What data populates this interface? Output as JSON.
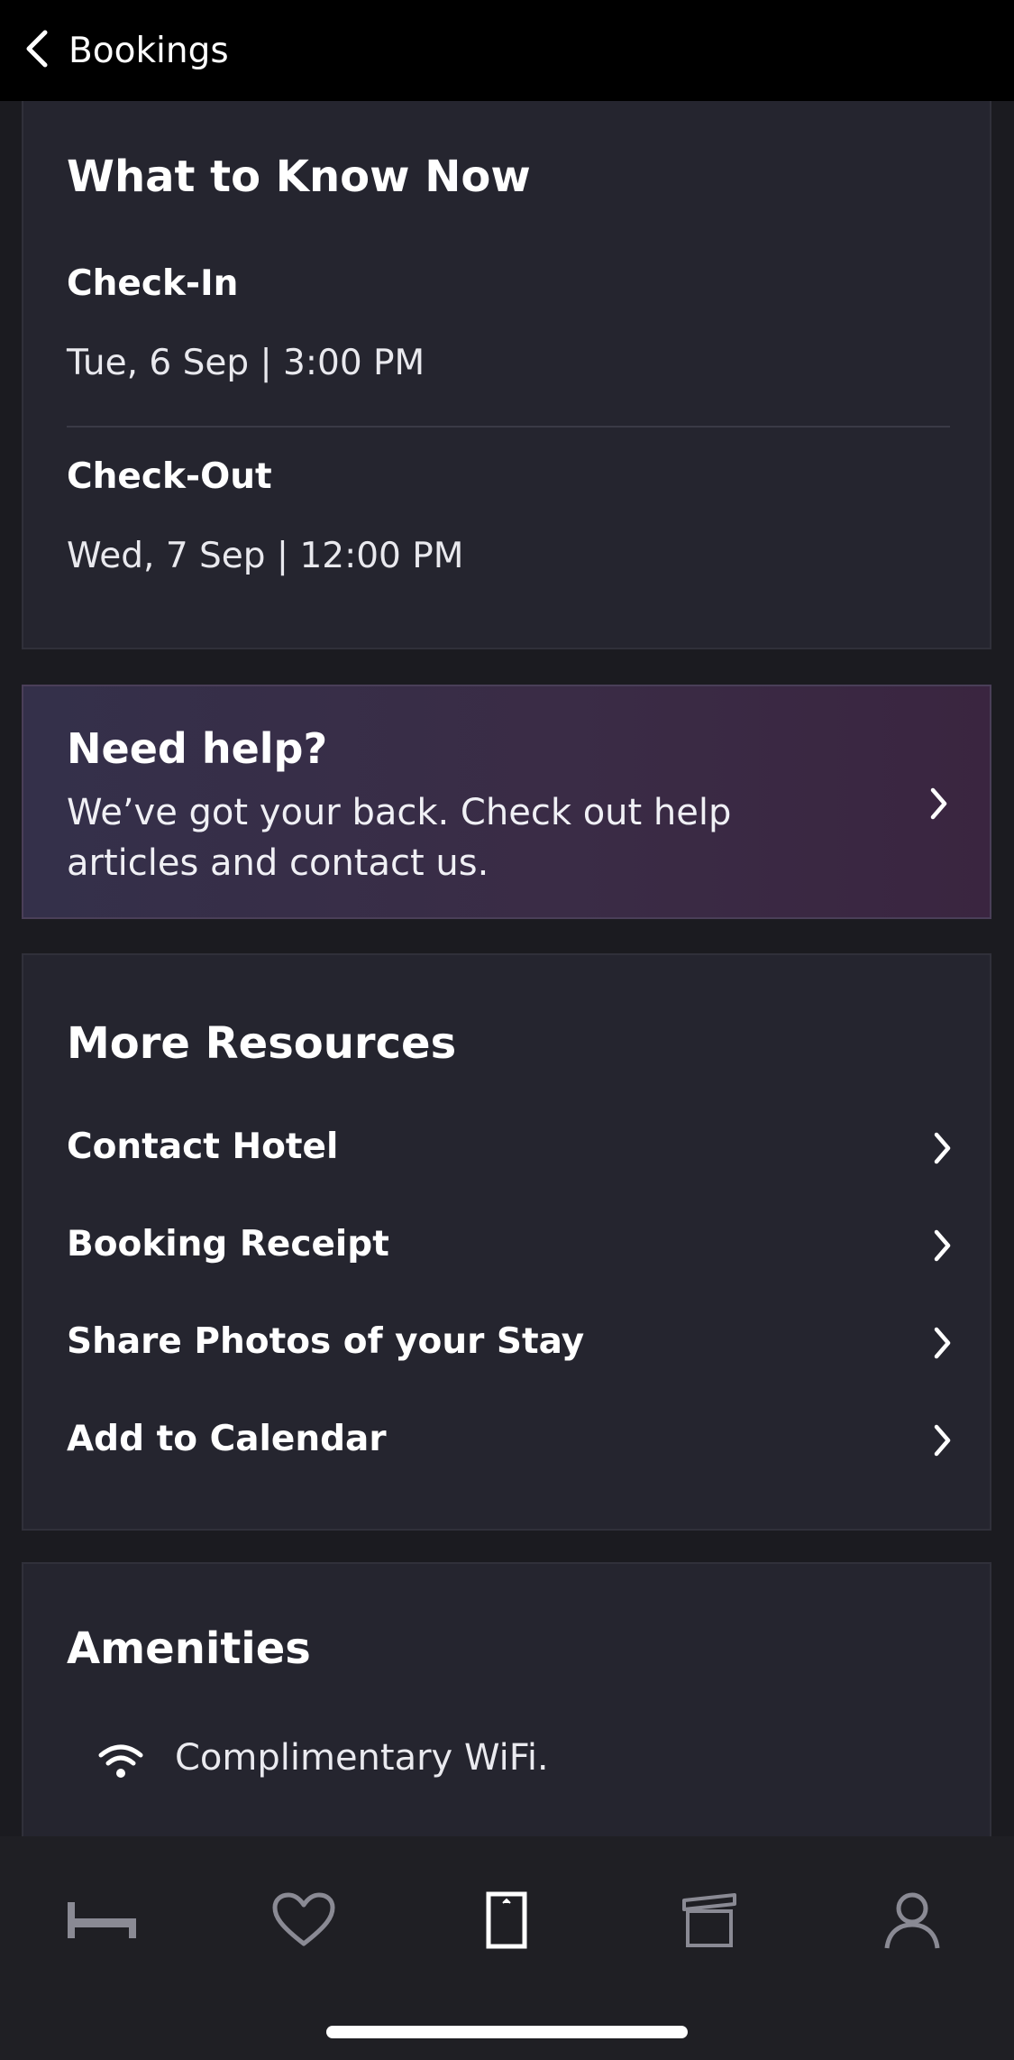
{
  "header": {
    "back_label": "Bookings"
  },
  "know_now": {
    "title": "What to Know Now",
    "check_in_label": "Check-In",
    "check_in_value": "Tue, 6 Sep | 3:00 PM",
    "check_out_label": "Check-Out",
    "check_out_value": "Wed, 7 Sep | 12:00 PM"
  },
  "help": {
    "title": "Need help?",
    "body": "We’ve got your back. Check out help articles and contact us."
  },
  "resources": {
    "title": "More Resources",
    "items": [
      {
        "label": "Contact Hotel"
      },
      {
        "label": "Booking Receipt"
      },
      {
        "label": "Share Photos of your Stay"
      },
      {
        "label": "Add to Calendar"
      }
    ]
  },
  "amenities": {
    "title": "Amenities",
    "items": [
      {
        "icon": "wifi-icon",
        "label": "Complimentary WiFi."
      }
    ]
  },
  "tabbar": {
    "tabs": [
      {
        "icon": "bed-icon",
        "active": false
      },
      {
        "icon": "heart-icon",
        "active": false
      },
      {
        "icon": "booking-card-icon",
        "active": true
      },
      {
        "icon": "gift-icon",
        "active": false
      },
      {
        "icon": "profile-icon",
        "active": false
      }
    ],
    "active_color": "#ffffff",
    "inactive_color": "#8a8a94"
  }
}
